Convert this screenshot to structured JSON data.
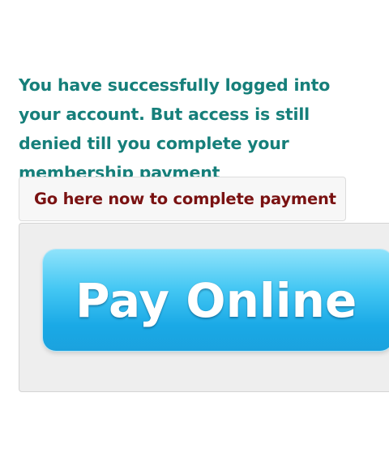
{
  "message": {
    "text": "You have successfully logged into your account. But access is still denied till you complete your membership payment"
  },
  "payment_link": {
    "label": "Go here now to complete payment"
  },
  "pay_online_button": {
    "label": "Pay Online"
  },
  "colors": {
    "message_text": "#167f7a",
    "link_text": "#7a1212",
    "button_blue": "#1aa9e6"
  }
}
